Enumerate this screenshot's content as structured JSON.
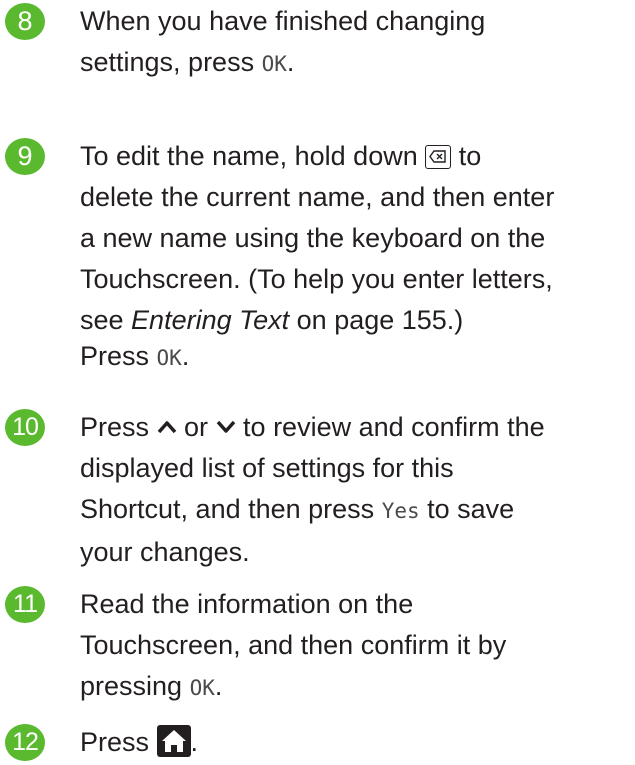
{
  "steps": [
    {
      "number": "8",
      "lines": {
        "l1": "When you have finished changing",
        "l2_pre": "settings, press ",
        "l2_code": "OK",
        "l2_post": "."
      }
    },
    {
      "number": "9",
      "lines": {
        "l1_pre": "To edit the name, hold down ",
        "l1_post": " to",
        "l2": "delete the current name, and then enter",
        "l3": "a new name using the keyboard on the",
        "l4": "Touchscreen. (To help you enter letters,",
        "l5_pre": "see ",
        "l5_em": "Entering Text",
        "l5_post": " on page 155.)",
        "l6_pre": "Press ",
        "l6_code": "OK",
        "l6_post": "."
      },
      "icon": "backspace-key-icon"
    },
    {
      "number": "10",
      "lines": {
        "l1_pre": "Press ",
        "l1_mid": " or ",
        "l1_post": " to review and confirm the",
        "l2": "displayed list of settings for this",
        "l3_pre": "Shortcut, and then press ",
        "l3_code": "Yes",
        "l3_post": " to save",
        "l4": "your changes."
      },
      "icons": [
        "up-arrow-icon",
        "down-arrow-icon"
      ]
    },
    {
      "number": "11",
      "lines": {
        "l1": "Read the information on the",
        "l2": "Touchscreen, and then confirm it by",
        "l3_pre": "pressing ",
        "l3_code": "OK",
        "l3_post": "."
      }
    },
    {
      "number": "12",
      "lines": {
        "l1_pre": "Press ",
        "l1_post": "."
      },
      "icon": "home-icon"
    }
  ],
  "colors": {
    "step_badge": "#5bb92f",
    "text": "#231f20",
    "code": "#4a4a4a"
  }
}
